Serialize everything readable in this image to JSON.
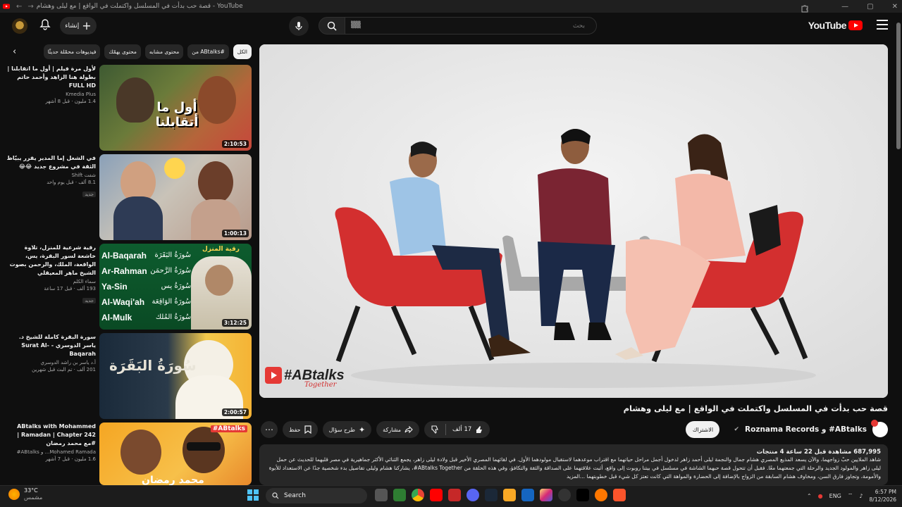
{
  "window": {
    "title": "قصة حب بدأت في المسلسل واكتملت في الواقع | مع ليلى وهشام - YouTube",
    "controls": [
      "—",
      "▢",
      "✕"
    ]
  },
  "header": {
    "logo_text": "YouTube",
    "search_placeholder": "بحث",
    "search_value": "▒▒",
    "create_label": "إنشاء"
  },
  "chips": [
    "الكل",
    "من ABtalks#",
    "محتوى مشابه",
    "محتوى يهمّك",
    "فيديوهات محمّلة حديثًا"
  ],
  "player": {
    "brand": "#ABtalks",
    "brand_sub": "Together"
  },
  "video": {
    "title": "قصة حب بدأت في المسلسل واكتملت في الواقع | مع ليلى وهشام",
    "channel": "ABtalks# و Roznama Records",
    "subscribe_label": "الاشتراك",
    "likes": "17 ألف",
    "share_label": "مشاركة",
    "ask_label": "طرح سؤال",
    "save_label": "حفظ",
    "views_meta": "687,995 مشاهدة قبل 22 ساعة 4 منتجات",
    "description": "شاهد الملايين حبّ زواجهما، والآن يسعد المذيع المصري هشام جمال والنجمة ليلى أحمد زاهر لدخول أجمل مراحل حياتهما مع اقتراب موعدهما لاستقبال مولودهما الأول. في لقائهما المصري الأخير قبل ولادة ليلى زاهر، يجمع الثنائي الأكثر جماهيرية في مصر قلبهما للحديث عن حمل ليلى زاهر والمولود الجديد والرحلة التي جمعتهما معًا. فقبل أن تتحول قصة حبهما الشاشة في مسلسل في بيتنا روبوت إلى واقع، أثبت علاقتهما على الصداقة والثقة والتكافؤ، وفي هذه الحلقة من ABtalks Together#، يشاركنا هشام وليلى تفاصيل بدء شخصية جدًا عن الاستعداد للأبوة والأمومة، وتجاوز فارق السن، ومخاوف هشام السابقة من الزواج بالإضافة إلى الحضارة والمواهة التي كانت تعتز كل شيء قبل خطوبتهما ...المزيد"
  },
  "recommendations": [
    {
      "title": "لأول مرة فيلم | أول ما اتقابلنا | بطولة هنا الزاهد وأحمد حاتم FULL HD",
      "channel": "Kmedia Plus",
      "meta": "1.4 مليون · قبل 8 أشهر",
      "duration": "2:10:53",
      "badge": "",
      "thumb_text": "أول ما أتقابلنا"
    },
    {
      "title": "في الشغل إما المدير يقرر يبيّاظ الثقة في مشروع جديد 😂😂",
      "channel": "شفت Shift",
      "meta": "8.1 ألف · قبل يوم واحد",
      "duration": "1:00:13",
      "badge": "جديد",
      "thumb_text": ""
    },
    {
      "title": "رقية شرعية للمنزل، تلاوة خاشعة لسور البقرة، يس، الواقعة، الملك، والرحمن بصوت الشيخ ماهر المعيقلي",
      "channel": "سماء الكلم",
      "meta": "193 ألف · قبل 17 ساعة",
      "duration": "3:12:25",
      "badge": "جديد",
      "thumb_text": "رقية المنزل",
      "surahs_en": [
        "Al-Baqarah",
        "Ar-Rahman",
        "Ya-Sin",
        "Al-Waqi'ah",
        "Al-Mulk"
      ],
      "surahs_ar": [
        "سُورَةُ البَقَرَة",
        "سُورَةُ الرَّحمَن",
        "سُورَةُ يس",
        "سُورَةُ الوَاقِعَة",
        "سُورَةُ المُلك"
      ]
    },
    {
      "title": "سورة البقرة كاملة للشيخ د. ياسر الدوسري - Surat Al-Baqarah",
      "channel": "أ.د ياسر بن راشد الدوسري",
      "meta": "201 ألف · تم البث قبل شهرين",
      "duration": "2:00:57",
      "badge": "",
      "thumb_text": "سُورَةُ البَقَرَة"
    },
    {
      "title": "ABtalks with Mohammed Ramadan | Chapter 242 | #مع محمد رمضان",
      "channel": "Mohamed Ramada... و ABtalks#",
      "meta": "1.6 مليون · قبل 7 أشهر",
      "duration": "",
      "badge": "",
      "thumb_text": "#ABtalks",
      "thumb_text2": "محمد رمضان"
    }
  ],
  "taskbar": {
    "temp": "33°C",
    "weather": "مشمس",
    "search": "Search",
    "lang": "ENG",
    "time": "6:57 PM",
    "date": "8/12/2026"
  },
  "colors": {
    "accent": "#ff0000",
    "chair_red": "#d32f2f",
    "background": "#0f0f0f"
  }
}
